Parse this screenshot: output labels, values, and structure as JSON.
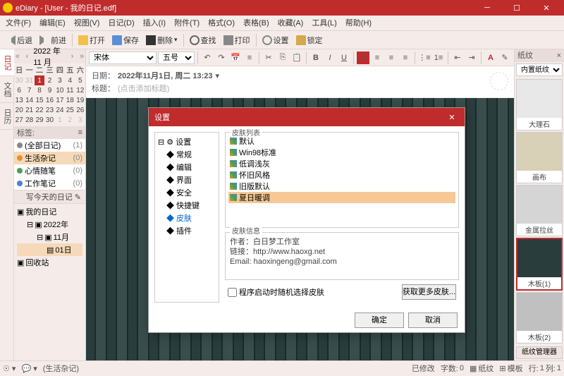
{
  "title": "eDiary - [User - 我的日记.edf]",
  "menu": [
    "文件(F)",
    "编辑(E)",
    "视图(V)",
    "日记(D)",
    "插入(I)",
    "附件(T)",
    "格式(O)",
    "表格(B)",
    "收藏(A)",
    "工具(L)",
    "帮助(H)"
  ],
  "toolbar": {
    "back": "后退",
    "forward": "前进",
    "open": "打开",
    "save": "保存",
    "delete": "删除",
    "search": "查找",
    "print": "打印",
    "settings": "设置",
    "lock": "锁定"
  },
  "sidetabs": [
    "日记",
    "文档",
    "日历"
  ],
  "calendar": {
    "title": "2022 年 11 月",
    "dow": [
      "日",
      "一",
      "二",
      "三",
      "四",
      "五",
      "六"
    ],
    "rows": [
      [
        "30",
        "31",
        "1",
        "2",
        "3",
        "4",
        "5"
      ],
      [
        "6",
        "7",
        "8",
        "9",
        "10",
        "11",
        "12"
      ],
      [
        "13",
        "14",
        "15",
        "16",
        "17",
        "18",
        "19"
      ],
      [
        "20",
        "21",
        "22",
        "23",
        "24",
        "25",
        "26"
      ],
      [
        "27",
        "28",
        "29",
        "30",
        "1",
        "2",
        "3"
      ]
    ],
    "today": "1"
  },
  "tags": {
    "header": "标签:",
    "items": [
      {
        "name": "(全部日记)",
        "count": "(1)",
        "color": "#888"
      },
      {
        "name": "生活杂记",
        "count": "(0)",
        "color": "#e89030",
        "sel": true
      },
      {
        "name": "心情随笔",
        "count": "(0)",
        "color": "#4aa050"
      },
      {
        "name": "工作笔记",
        "count": "(0)",
        "color": "#4a7fd6"
      }
    ],
    "write": "写今天的日记"
  },
  "tree": {
    "root": "我的日记",
    "year": "2022年",
    "month": "11月",
    "day": "01日",
    "trash": "回收站"
  },
  "editor": {
    "font": "宋体",
    "size": "五号",
    "date_label": "日期：",
    "date": "2022年11月1日, 周二 13:23",
    "title_label": "标题：",
    "title_placeholder": "(点击添加标题)"
  },
  "rightpanel": {
    "header": "纸纹",
    "preset": "内置纸纹",
    "textures": [
      {
        "name": "大理石",
        "bg": "#e8e8e8"
      },
      {
        "name": "画布",
        "bg": "#d9d0b8"
      },
      {
        "name": "金属拉丝",
        "bg": "#d5d5d5"
      },
      {
        "name": "木板(1)",
        "bg": "#2a3d3d",
        "sel": true
      },
      {
        "name": "木板(2)",
        "bg": "#c0c0c0"
      }
    ],
    "manager": "纸纹管理器"
  },
  "dialog": {
    "title": "设置",
    "tree": [
      "设置",
      "常规",
      "编辑",
      "界面",
      "安全",
      "快捷键",
      "皮肤",
      "插件"
    ],
    "tree_sel": "皮肤",
    "skin_label": "皮肤列表",
    "skins": [
      "默认",
      "Win98标准",
      "低调浅灰",
      "怀旧风格",
      "旧版默认",
      "夏日暖调"
    ],
    "skin_sel": "夏日暖调",
    "info_label": "皮肤信息",
    "info_author": "作者：白日梦工作室",
    "info_link": "链接：http://www.haoxg.net",
    "info_email": "Email: haoxingeng@gmail.com",
    "random_chk": "程序启动时随机选择皮肤",
    "more": "获取更多皮肤...",
    "ok": "确定",
    "cancel": "取消"
  },
  "status": {
    "tab": "(生活杂记)",
    "modified": "已修改",
    "chars_label": "字数:",
    "chars": "0",
    "row_label": "行:",
    "row": "1",
    "col_label": "列:",
    "col": "1",
    "texture": "纸纹",
    "template": "模板"
  }
}
